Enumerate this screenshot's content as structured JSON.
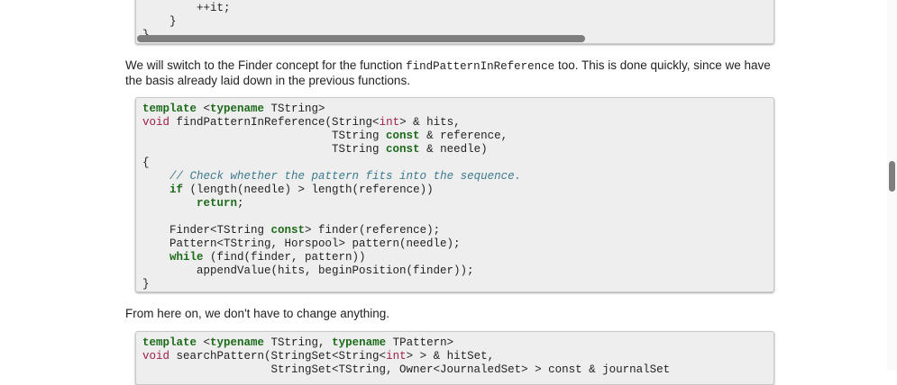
{
  "block1": {
    "lines": [
      "        ++it;",
      "    }",
      "}"
    ]
  },
  "paragraph1": {
    "text_before": "We will switch to the Finder concept for the function ",
    "code": "findPatternInReference",
    "text_after": " too. This is done quickly, since we have the basis already laid down in the previous functions."
  },
  "block2": {
    "comment": "// Check whether the pattern fits into the sequence.",
    "kw_template": "template",
    "kw_typename": "typename",
    "kw_void": "void",
    "kw_const": "const",
    "kw_if": "if",
    "kw_return": "return",
    "kw_while": "while",
    "ty_int": "int"
  },
  "paragraph2": {
    "text": "From here on, we don't have to change anything."
  },
  "block3": {
    "kw_template": "template",
    "kw_typename": "typename",
    "kw_void": "void",
    "ty_int": "int"
  },
  "colors": {
    "keyword": "#1c6b1a",
    "type": "#a02048",
    "comment": "#3c7a8c",
    "code_background": "#eeeeee"
  }
}
